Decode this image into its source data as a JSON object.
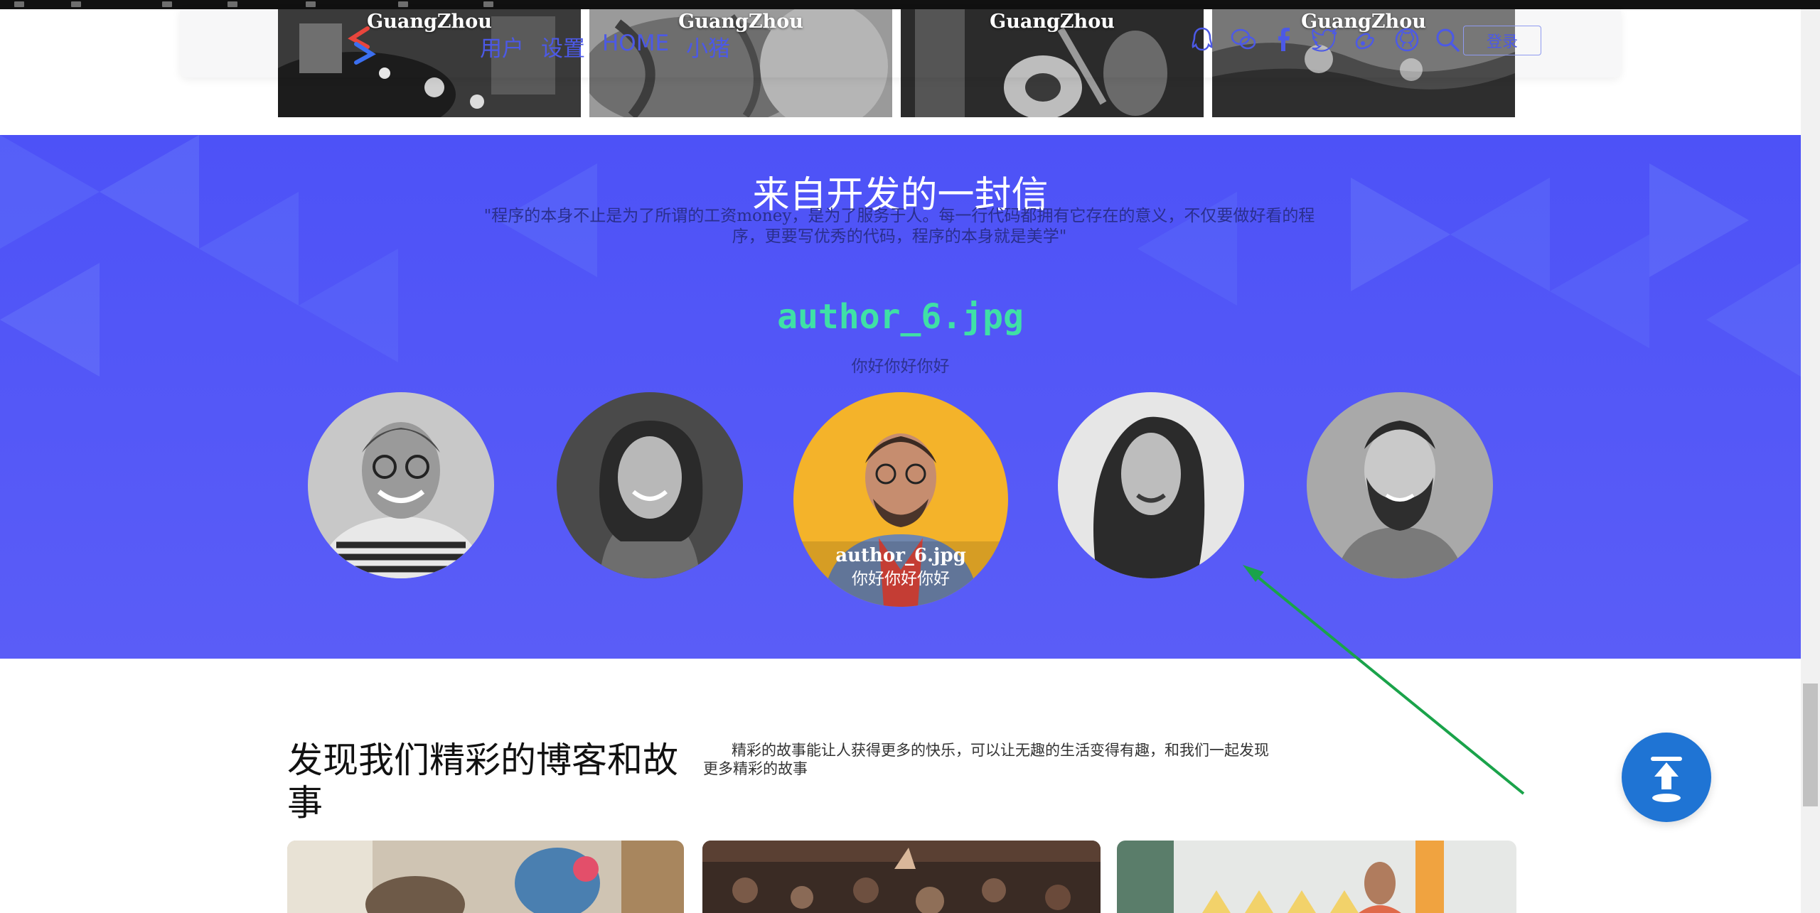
{
  "gallery": {
    "tiles": [
      {
        "caption": "GuangZhou"
      },
      {
        "caption": "GuangZhou"
      },
      {
        "caption": "GuangZhou"
      },
      {
        "caption": "GuangZhou"
      }
    ]
  },
  "nav": {
    "links": [
      {
        "label": "用户"
      },
      {
        "label": "设置"
      },
      {
        "label": "HOME"
      },
      {
        "label": "小猪"
      }
    ],
    "icons": [
      "qq-icon",
      "wechat-icon",
      "facebook-icon",
      "twitter-icon",
      "weibo-icon",
      "github-icon",
      "search-icon"
    ],
    "login_label": "登录"
  },
  "hero": {
    "title": "来自开发的一封信",
    "quote": "\"程序的本身不止是为了所谓的工资money，是为了服务于人。每一行代码都拥有它存在的意义，不仅要做好看的程序，更要写优秀的代码，程序的本身就是美学\"",
    "name": "author_6.jpg",
    "subtitle": "你好你好你好",
    "active_avatar": {
      "caption_name": "author_6.jpg",
      "caption_sub": "你好你好你好"
    }
  },
  "blog": {
    "heading": "发现我们精彩的博客和故事",
    "description": "精彩的故事能让人获得更多的快乐，可以让无趣的生活变得有趣，和我们一起发现更多精彩的故事"
  },
  "colors": {
    "hero_bg": "#5055f7",
    "accent_green": "#3fe0a6",
    "nav_link": "#4c59e6",
    "back_top": "#1f74d4",
    "annotation_arrow": "#1aa34a"
  }
}
